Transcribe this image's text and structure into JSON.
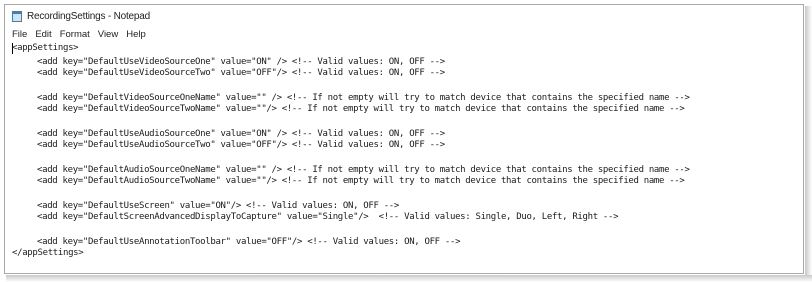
{
  "window": {
    "title": "RecordingSettings - Notepad",
    "icon": "notepad-icon"
  },
  "menu": {
    "items": [
      "File",
      "Edit",
      "Format",
      "View",
      "Help"
    ]
  },
  "editor": {
    "lines": [
      "<appSettings>",
      "<add key=\"DefaultUseVideoSourceOne\" value=\"ON\" /> <!-- Valid values: ON, OFF -->",
      "<add key=\"DefaultUseVideoSourceTwo\" value=\"OFF\"/> <!-- Valid values: ON, OFF -->",
      "<add key=\"DefaultVideoSourceOneName\" value=\"\" /> <!-- If not empty will try to match device that contains the specified name -->",
      "<add key=\"DefaultVideoSourceTwoName\" value=\"\"/> <!-- If not empty will try to match device that contains the specified name -->",
      "<add key=\"DefaultUseAudioSourceOne\" value=\"ON\" /> <!-- Valid values: ON, OFF -->",
      "<add key=\"DefaultUseAudioSourceTwo\" value=\"OFF\"/> <!-- Valid values: ON, OFF -->",
      "<add key=\"DefaultAudioSourceOneName\" value=\"\" /> <!-- If not empty will try to match device that contains the specified name -->",
      "<add key=\"DefaultAudioSourceTwoName\" value=\"\"/> <!-- If not empty will try to match device that contains the specified name -->",
      "<add key=\"DefaultUseScreen\" value=\"ON\"/> <!-- Valid values: ON, OFF -->",
      "<add key=\"DefaultScreenAdvancedDisplayToCapture\" value=\"Single\"/>  <!-- Valid values: Single, Duo, Left, Right -->",
      "<add key=\"DefaultUseAnnotationToolbar\" value=\"OFF\"/> <!-- Valid values: ON, OFF -->",
      "</appSettings>"
    ]
  }
}
